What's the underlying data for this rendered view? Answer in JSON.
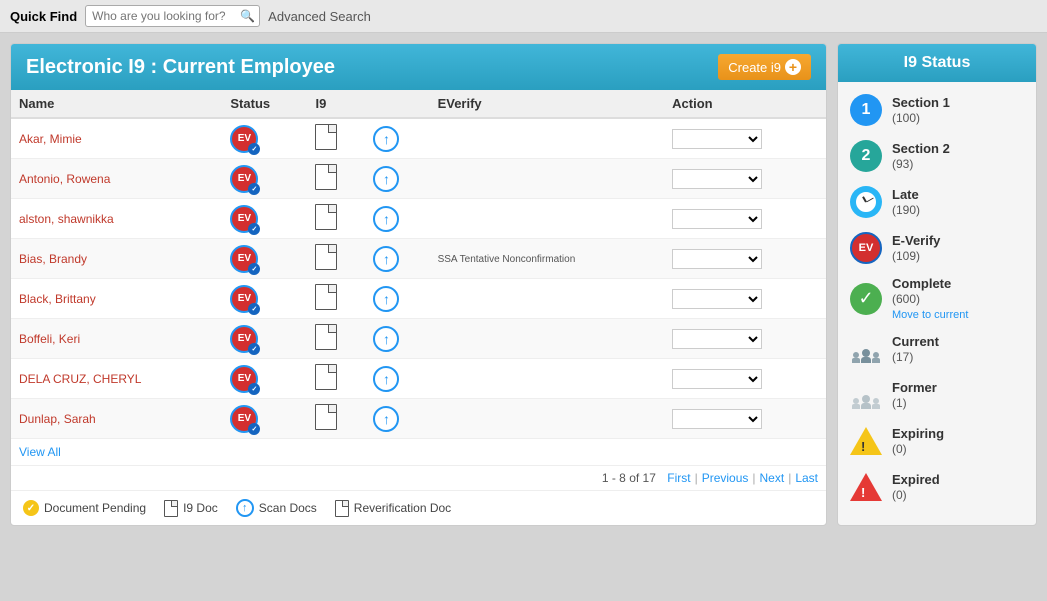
{
  "topbar": {
    "quick_find_label": "Quick Find",
    "search_placeholder": "Who are you looking for?",
    "advanced_search_label": "Advanced Search"
  },
  "header": {
    "title": "Electronic I9 : Current Employee",
    "create_button_label": "Create i9"
  },
  "table": {
    "columns": [
      "Name",
      "Status",
      "I9",
      "EVerify",
      "Action"
    ],
    "rows": [
      {
        "name": "Akar, Mimie",
        "status": "EV",
        "everify": "",
        "action": ""
      },
      {
        "name": "Antonio, Rowena",
        "status": "EV",
        "everify": "",
        "action": ""
      },
      {
        "name": "alston, shawnikka",
        "status": "EV",
        "everify": "",
        "action": ""
      },
      {
        "name": "Bias, Brandy",
        "status": "EV",
        "everify": "SSA Tentative Nonconfirmation",
        "action": ""
      },
      {
        "name": "Black, Brittany",
        "status": "EV",
        "everify": "",
        "action": ""
      },
      {
        "name": "Boffeli, Keri",
        "status": "EV",
        "everify": "",
        "action": ""
      },
      {
        "name": "DELA CRUZ, CHERYL",
        "status": "EV",
        "everify": "",
        "action": ""
      },
      {
        "name": "Dunlap, Sarah",
        "status": "EV",
        "everify": "",
        "action": ""
      }
    ],
    "view_all_label": "View All",
    "pagination": {
      "info": "1 - 8 of 17",
      "first": "First",
      "previous": "Previous",
      "next": "Next",
      "last": "Last"
    }
  },
  "legend": {
    "items": [
      {
        "label": "Document Pending"
      },
      {
        "label": "I9 Doc"
      },
      {
        "label": "Scan Docs"
      },
      {
        "label": "Reverification Doc"
      }
    ]
  },
  "status_panel": {
    "title": "I9 Status",
    "items": [
      {
        "label": "Section 1",
        "count": "(100)",
        "type": "section1"
      },
      {
        "label": "Section 2",
        "count": "(93)",
        "type": "section2"
      },
      {
        "label": "Late",
        "count": "(190)",
        "type": "late"
      },
      {
        "label": "E-Verify",
        "count": "(109)",
        "type": "everify"
      },
      {
        "label": "Complete",
        "count": "(600)",
        "type": "complete",
        "extra": "Move to current"
      },
      {
        "label": "Current",
        "count": "(17)",
        "type": "current"
      },
      {
        "label": "Former",
        "count": "(1)",
        "type": "former"
      },
      {
        "label": "Expiring",
        "count": "(0)",
        "type": "expiring"
      },
      {
        "label": "Expired",
        "count": "(0)",
        "type": "expired"
      }
    ]
  }
}
